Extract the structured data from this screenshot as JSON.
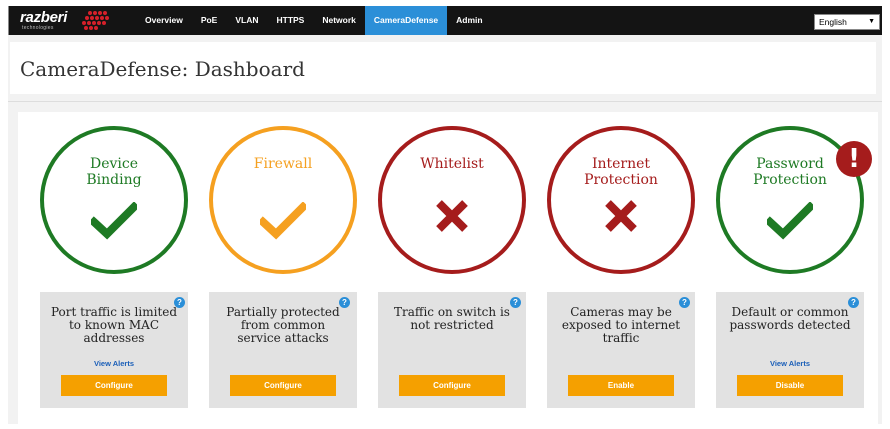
{
  "header": {
    "logo_text": "razberi",
    "logo_sub": "technologies",
    "nav": [
      {
        "label": "Overview"
      },
      {
        "label": "PoE"
      },
      {
        "label": "VLAN"
      },
      {
        "label": "HTTPS"
      },
      {
        "label": "Network"
      },
      {
        "label": "CameraDefense",
        "active": true
      },
      {
        "label": "Admin"
      }
    ],
    "language": "English"
  },
  "page": {
    "title": "CameraDefense: Dashboard"
  },
  "colors": {
    "ok": "#1e7a24",
    "warn": "#f5a020",
    "bad": "#a51c1c",
    "accent": "#2b8fd8",
    "button": "#f5a000"
  },
  "modules": [
    {
      "name_line1": "Device",
      "name_line2": "Binding",
      "status": "ok",
      "icon": "check-icon",
      "description": [
        "Port traffic is limited",
        "to known MAC",
        "addresses"
      ],
      "link": "View Alerts",
      "button": "Configure"
    },
    {
      "name_line1": "Firewall",
      "name_line2": "",
      "status": "warn",
      "icon": "check-icon",
      "description": [
        "Partially protected",
        "from common",
        "service attacks"
      ],
      "link": "",
      "button": "Configure"
    },
    {
      "name_line1": "Whitelist",
      "name_line2": "",
      "status": "bad",
      "icon": "x-icon",
      "description": [
        "Traffic on switch is",
        "not restricted"
      ],
      "link": "",
      "button": "Configure"
    },
    {
      "name_line1": "Internet",
      "name_line2": "Protection",
      "status": "bad",
      "icon": "x-icon",
      "description": [
        "Cameras may be",
        "exposed to internet",
        "traffic"
      ],
      "link": "",
      "button": "Enable"
    },
    {
      "name_line1": "Password",
      "name_line2": "Protection",
      "status": "ok",
      "icon": "check-icon",
      "description": [
        "Default or common",
        "passwords detected"
      ],
      "link": "View Alerts",
      "button": "Disable",
      "alert_badge": "!"
    }
  ]
}
